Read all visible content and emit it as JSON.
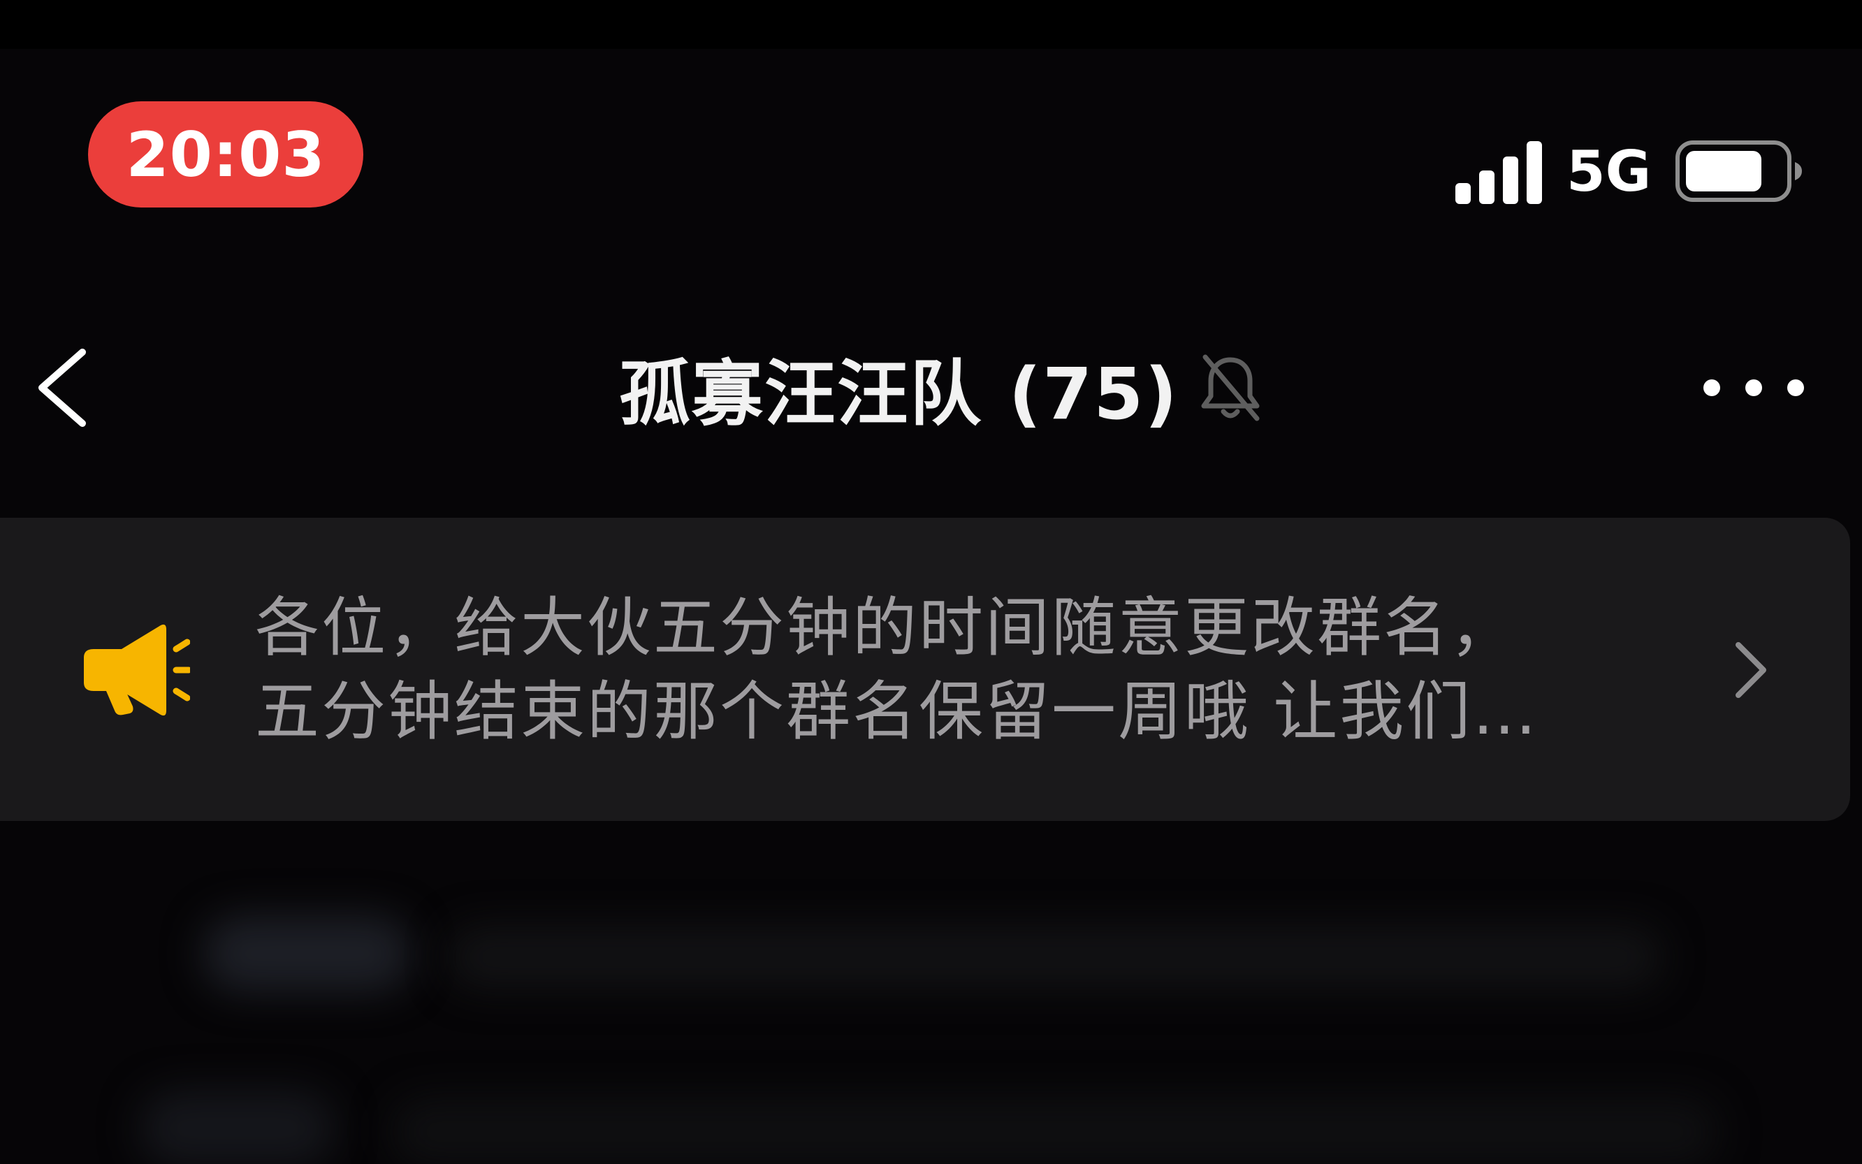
{
  "status_bar": {
    "time": "20:03",
    "network": "5G",
    "time_pill_color": "#eb3e3b",
    "signal_icon": "cellular-signal-icon",
    "battery_icon": "battery-icon"
  },
  "nav": {
    "back_icon": "chevron-left-icon",
    "title": "孤寡汪汪队 (75)",
    "mute_icon": "bell-slash-icon",
    "more_icon": "ellipsis-icon"
  },
  "announcement": {
    "icon": "megaphone-icon",
    "icon_color": "#f7b500",
    "line1": "各位，给大伙五分钟的时间随意更改群名，",
    "line2": "五分钟结束的那个群名保留一周哦 让我们…",
    "chevron_icon": "chevron-right-icon"
  }
}
